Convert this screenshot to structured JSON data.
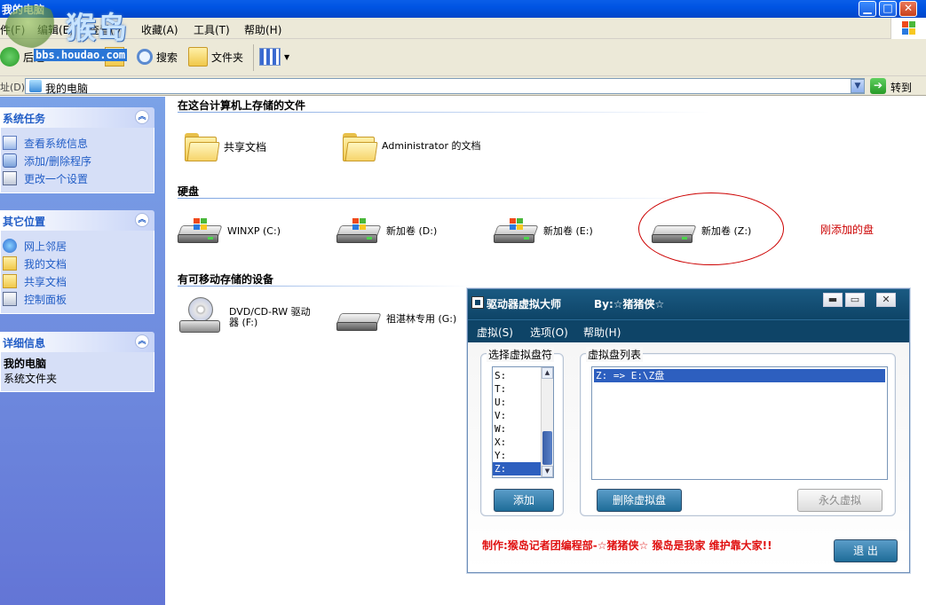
{
  "window": {
    "title": "我的电脑"
  },
  "watermark": {
    "text": "猴岛",
    "url": "bbs.houdao.com"
  },
  "menu": [
    "件(F)",
    "编辑(E)",
    "查看(V)",
    "收藏(A)",
    "工具(T)",
    "帮助(H)"
  ],
  "toolbar": {
    "back": "后退",
    "search": "搜索",
    "folders": "文件夹"
  },
  "address": {
    "label": "址(D)",
    "value": "我的电脑",
    "go": "转到"
  },
  "taskpane": {
    "system_tasks": {
      "title": "系统任务",
      "items": [
        "查看系统信息",
        "添加/删除程序",
        "更改一个设置"
      ]
    },
    "other_places": {
      "title": "其它位置",
      "items": [
        "网上邻居",
        "我的文档",
        "共享文档",
        "控制面板"
      ]
    },
    "details": {
      "title": "详细信息",
      "name": "我的电脑",
      "type": "系统文件夹"
    }
  },
  "groups": {
    "stored": {
      "title": "在这台计算机上存储的文件",
      "items": [
        "共享文档",
        "Administrator 的文档"
      ]
    },
    "hdd": {
      "title": "硬盘",
      "items": [
        "WINXP (C:)",
        "新加卷 (D:)",
        "新加卷 (E:)",
        "新加卷 (Z:)"
      ]
    },
    "removable": {
      "title": "有可移动存储的设备",
      "items": [
        "DVD/CD-RW 驱动器 (F:)",
        "祖湛林专用 (G:)"
      ]
    }
  },
  "annotation": "刚添加的盘",
  "dialog": {
    "title": "驱动器虚拟大师",
    "by": "By:☆猪猪侠☆",
    "menu": [
      "虚拟(S)",
      "选项(O)",
      "帮助(H)"
    ],
    "left_group": "选择虚拟盘符",
    "letters": [
      "S:",
      "T:",
      "U:",
      "V:",
      "W:",
      "X:",
      "Y:",
      "Z:"
    ],
    "selected_letter": "Z:",
    "right_group": "虚拟盘列表",
    "list_items": [
      "Z: => E:\\Z盘"
    ],
    "add_button": "添加",
    "delete_button": "删除虚拟盘",
    "permanent_button": "永久虚拟",
    "credit": "制作:猴岛记者团编程部-☆猪猪侠☆   猴岛是我家 维护靠大家!!",
    "exit_button": "退 出"
  },
  "colors": {
    "accent": "#215dc6",
    "dialog_header": "#0e4467",
    "annotation": "#cc0000"
  }
}
